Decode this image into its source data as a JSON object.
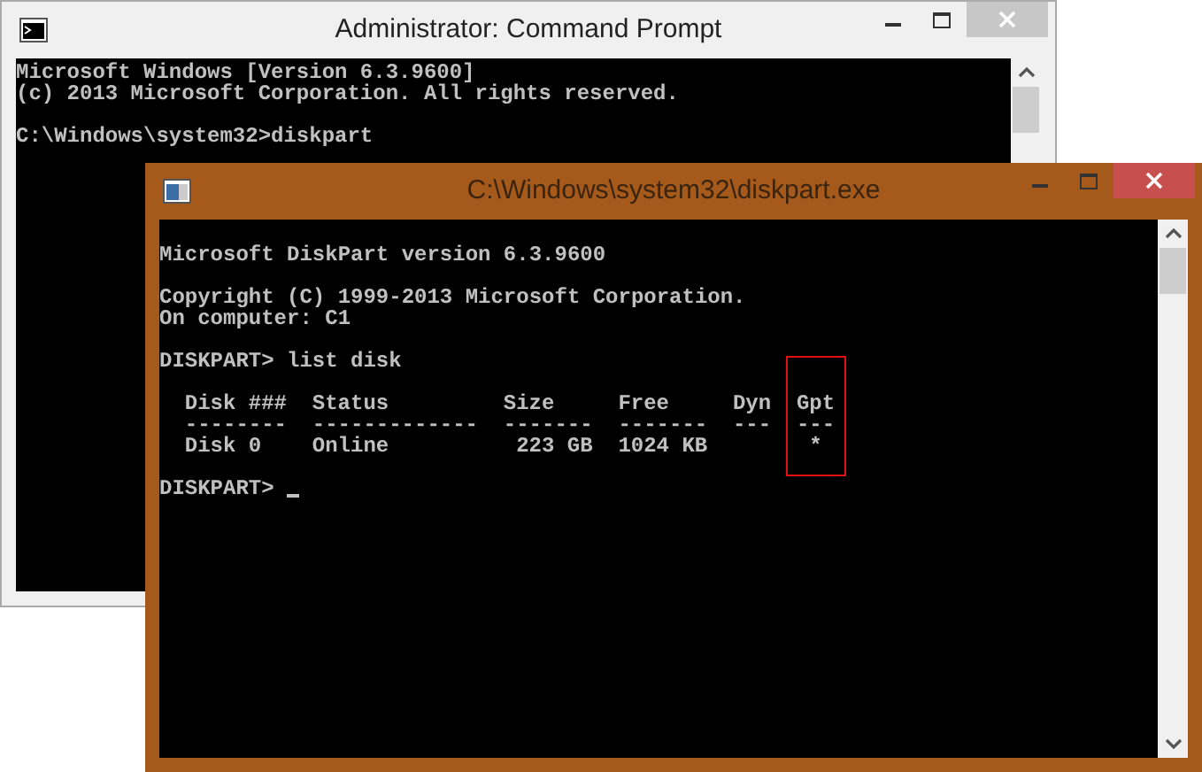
{
  "windows": [
    {
      "title": "Administrator: Command Prompt",
      "active": false,
      "blocks": [
        [
          "Microsoft Windows [Version 6.3.9600]",
          "(c) 2013 Microsoft Corporation. All rights reserved."
        ],
        [
          "C:\\Windows\\system32>diskpart"
        ]
      ]
    },
    {
      "title": "C:\\Windows\\system32\\diskpart.exe",
      "active": true,
      "blocks": [
        [
          "Microsoft DiskPart version 6.3.9600"
        ],
        [
          "Copyright (C) 1999-2013 Microsoft Corporation.",
          "On computer: C1"
        ],
        [
          "DISKPART> list disk"
        ]
      ],
      "table": {
        "columns": [
          {
            "header": "Disk ###",
            "rule": "--------",
            "kind": "text",
            "highlighted": false
          },
          {
            "header": "Status",
            "rule": "-------------",
            "kind": "text",
            "highlighted": false
          },
          {
            "header": "Size",
            "rule": "-------",
            "kind": "number",
            "highlighted": false
          },
          {
            "header": "Free",
            "rule": "-------",
            "kind": "number",
            "highlighted": false
          },
          {
            "header": "Dyn",
            "rule": "---",
            "highlighted": false
          },
          {
            "header": "Gpt",
            "rule": "---",
            "kind": "flag",
            "highlighted": true
          }
        ],
        "rows": [
          [
            "Disk 0",
            "Online",
            "223 GB",
            "1024 KB",
            null,
            "*"
          ]
        ]
      },
      "prompt": "DISKPART>",
      "cursor": true
    }
  ]
}
